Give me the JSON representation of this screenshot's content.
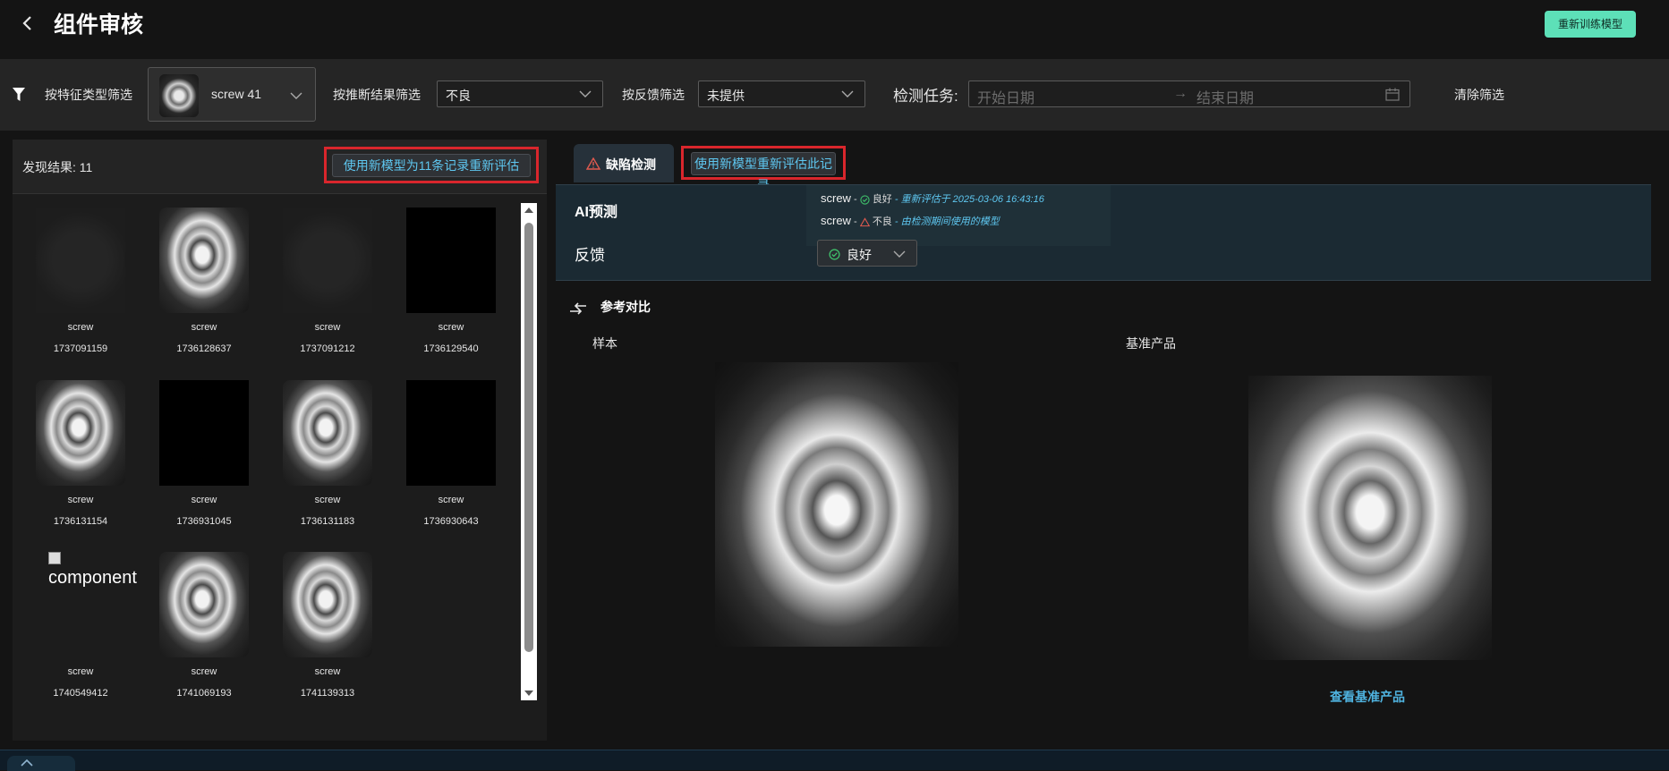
{
  "header": {
    "title": "组件审核",
    "retrain_label": "重新训练模型"
  },
  "filters": {
    "feature_label": "按特征类型筛选",
    "feature_value": "screw 41",
    "inference_label": "按推断结果筛选",
    "inference_value": "不良",
    "feedback_label": "按反馈筛选",
    "feedback_value": "未提供",
    "task_label": "检测任务:",
    "start_placeholder": "开始日期",
    "end_placeholder": "结束日期",
    "clear_label": "清除筛选"
  },
  "results": {
    "found_label": "发现结果: 11",
    "reeval_all_label": "使用新模型为11条记录重新评估",
    "items": [
      {
        "type": "screw",
        "id": "1737091159",
        "thumb": "faded"
      },
      {
        "type": "screw",
        "id": "1736128637",
        "thumb": "screw"
      },
      {
        "type": "screw",
        "id": "1737091212",
        "thumb": "faded"
      },
      {
        "type": "screw",
        "id": "1736129540",
        "thumb": "black"
      },
      {
        "type": "screw",
        "id": "1736131154",
        "thumb": "screw"
      },
      {
        "type": "screw",
        "id": "1736931045",
        "thumb": "black"
      },
      {
        "type": "screw",
        "id": "1736131183",
        "thumb": "screw"
      },
      {
        "type": "screw",
        "id": "1736930643",
        "thumb": "black"
      },
      {
        "type": "screw",
        "id": "1740549412",
        "thumb": "broken",
        "alt": "component"
      },
      {
        "type": "screw",
        "id": "1741069193",
        "thumb": "screw"
      },
      {
        "type": "screw",
        "id": "1741139313",
        "thumb": "screw"
      }
    ]
  },
  "detail": {
    "tab_label": "缺陷检测",
    "reeval_record_label": "使用新模型重新评估此记录",
    "ai_label": "AI预测",
    "feedback_label": "反馈",
    "predictions": [
      {
        "name": "screw",
        "sep": "-",
        "result": "良好",
        "status": "good",
        "note": "重新评估于 2025-03-06 16:43:16"
      },
      {
        "name": "screw",
        "sep": "-",
        "result": "不良",
        "status": "bad",
        "note": "由检测期间使用的模型"
      }
    ],
    "feedback_value": "良好",
    "compare_label": "参考对比",
    "sample_label": "样本",
    "base_label": "基准产品",
    "view_base_label": "查看基准产品"
  },
  "colors": {
    "accent": "#5de0b8",
    "link": "#5ec7f0",
    "highlight": "#d9262c",
    "good": "#3fbf6a",
    "bad": "#e05a4f"
  },
  "icons": {
    "back": "chevron-left-icon",
    "filter": "filter-icon",
    "calendar": "calendar-icon",
    "warning": "warning-icon",
    "compare": "compare-arrows-icon",
    "check": "check-circle-icon",
    "collapse": "chevron-up-icon"
  }
}
